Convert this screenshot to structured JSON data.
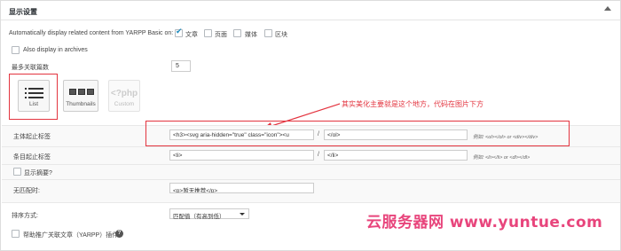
{
  "panel": {
    "title": "显示设置"
  },
  "auto_display": {
    "label": "Automatically display related content from YARPP Basic on:",
    "options": [
      {
        "label": "文章",
        "checked": true
      },
      {
        "label": "页面",
        "checked": false
      },
      {
        "label": "媒体",
        "checked": false
      },
      {
        "label": "区块",
        "checked": false
      }
    ]
  },
  "archives": {
    "label": "Also display in archives",
    "checked": false
  },
  "max_count": {
    "label": "最多关联篇数",
    "value": "5"
  },
  "templates": {
    "list": "List",
    "thumbnails": "Thumbnails",
    "custom": "Custom",
    "custom_glyph": "<?php"
  },
  "annotation": {
    "text": "其实美化主要就是这个地方，代码在图片下方",
    "color": "#e3343f"
  },
  "fields": {
    "before_after_related": {
      "label": "主体起止标签",
      "before": "<h3><svg aria-hidden=\"true\" class=\"icon\"><u",
      "after": "</ol>",
      "hint": "例如: <ol></ol> or <div></div>"
    },
    "before_after_each": {
      "label": "条目起止标签",
      "before": "<li>",
      "after": "</li>",
      "hint": "例如: <li></li> or <dl></dl>"
    },
    "show_excerpt": {
      "label": "显示摘要?",
      "checked": false
    },
    "no_results": {
      "label": "无匹配时:",
      "value": "<p>暂无推荐</p>"
    }
  },
  "order": {
    "label": "排序方式:",
    "selected": "匹配值（有高到低）"
  },
  "promote": {
    "label": "帮助推广关联文章（YARPP）插件?",
    "checked": false,
    "help": "?"
  },
  "watermark": {
    "text": "云服务器网 www.yuntue.com"
  },
  "colors": {
    "checkbox_check": "#1e8cbe",
    "annotation_red": "#e3343f",
    "watermark_pink": "#e8457c"
  }
}
